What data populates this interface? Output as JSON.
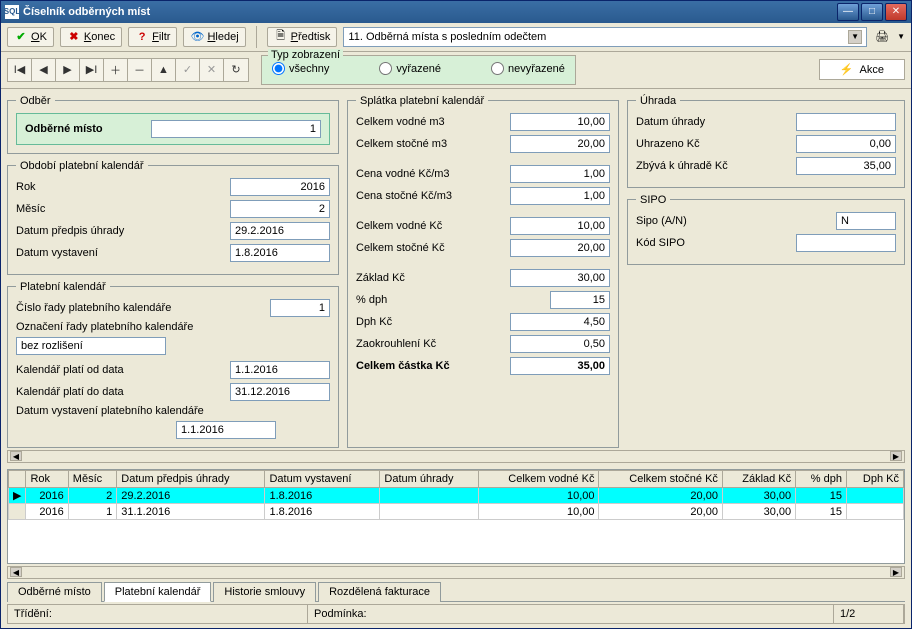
{
  "window": {
    "title": "Číselník odběrných míst",
    "icon_text": "SQL"
  },
  "toolbar": {
    "ok": "OK",
    "konec": "Konec",
    "filtr": "Filtr",
    "hledej": "Hledej",
    "predtisk": "Předtisk",
    "combo_value": "11. Odběrná místa s posledním odečtem"
  },
  "typ": {
    "legend": "Typ zobrazení",
    "vsechny": "všechny",
    "vyrazene": "vyřazené",
    "nevyrazene": "nevyřazené"
  },
  "akce": "Akce",
  "odber": {
    "legend": "Odběr",
    "odberne_misto_label": "Odběrné místo",
    "odberne_misto_value": "1"
  },
  "obdobi": {
    "legend": "Období platební kalendář",
    "rok_label": "Rok",
    "rok": "2016",
    "mesic_label": "Měsíc",
    "mesic": "2",
    "datum_predpis_label": "Datum předpis úhrady",
    "datum_predpis": "29.2.2016",
    "datum_vystaveni_label": "Datum vystavení",
    "datum_vystaveni": "1.8.2016"
  },
  "platkal": {
    "legend": "Platební kalendář",
    "cislo_rady_label": "Číslo řady platebního kalendáře",
    "cislo_rady": "1",
    "oznaceni_label": "Označení řady platebního kalendáře",
    "oznaceni": "bez rozlišení",
    "plati_od_label": "Kalendář platí od data",
    "plati_od": "1.1.2016",
    "plati_do_label": "Kalendář platí do data",
    "plati_do": "31.12.2016",
    "datum_vyst_pk_label": "Datum vystavení platebního kalendáře",
    "datum_vyst_pk": "1.1.2016"
  },
  "splatka": {
    "legend": "Splátka platební kalendář",
    "vodne_m3_label": "Celkem vodné m3",
    "vodne_m3": "10,00",
    "stocne_m3_label": "Celkem stočné m3",
    "stocne_m3": "20,00",
    "cena_vodne_label": "Cena vodné Kč/m3",
    "cena_vodne": "1,00",
    "cena_stocne_label": "Cena stočné Kč/m3",
    "cena_stocne": "1,00",
    "celkem_vodne_label": "Celkem vodné Kč",
    "celkem_vodne": "10,00",
    "celkem_stocne_label": "Celkem stočné Kč",
    "celkem_stocne": "20,00",
    "zaklad_label": "Základ Kč",
    "zaklad": "30,00",
    "dph_pct_label": "% dph",
    "dph_pct": "15",
    "dph_kc_label": "Dph Kč",
    "dph_kc": "4,50",
    "zaokrouhleni_label": "Zaokrouhlení Kč",
    "zaokrouhleni": "0,50",
    "celkem_castka_label": "Celkem částka Kč",
    "celkem_castka": "35,00"
  },
  "uhrada": {
    "legend": "Úhrada",
    "datum_label": "Datum úhrady",
    "datum": "",
    "uhrazeno_label": "Uhrazeno Kč",
    "uhrazeno": "0,00",
    "zbyva_label": "Zbývá k úhradě Kč",
    "zbyva": "35,00"
  },
  "sipo": {
    "legend": "SIPO",
    "sipo_an_label": "Sipo (A/N)",
    "sipo_an": "N",
    "kod_label": "Kód SIPO",
    "kod": ""
  },
  "grid": {
    "headers": {
      "rok": "Rok",
      "mesic": "Měsíc",
      "predpis": "Datum předpis úhrady",
      "vystaveni": "Datum vystavení",
      "uhrada": "Datum úhrady",
      "vodne": "Celkem vodné Kč",
      "stocne": "Celkem stočné Kč",
      "zaklad": "Základ Kč",
      "dph_pct": "% dph",
      "dph_kc": "Dph Kč"
    },
    "rows": [
      {
        "rok": "2016",
        "mesic": "2",
        "predpis": "29.2.2016",
        "vystaveni": "1.8.2016",
        "uhrada": "",
        "vodne": "10,00",
        "stocne": "20,00",
        "zaklad": "30,00",
        "dph_pct": "15",
        "dph_kc": ""
      },
      {
        "rok": "2016",
        "mesic": "1",
        "predpis": "31.1.2016",
        "vystaveni": "1.8.2016",
        "uhrada": "",
        "vodne": "10,00",
        "stocne": "20,00",
        "zaklad": "30,00",
        "dph_pct": "15",
        "dph_kc": ""
      }
    ]
  },
  "tabs": {
    "odberne": "Odběrné místo",
    "platkal": "Platební kalendář",
    "historie": "Historie smlouvy",
    "rozdelena": "Rozdělená fakturace"
  },
  "status": {
    "trideni": "Třídění:",
    "podminka": "Podmínka:",
    "page": "1/2"
  }
}
